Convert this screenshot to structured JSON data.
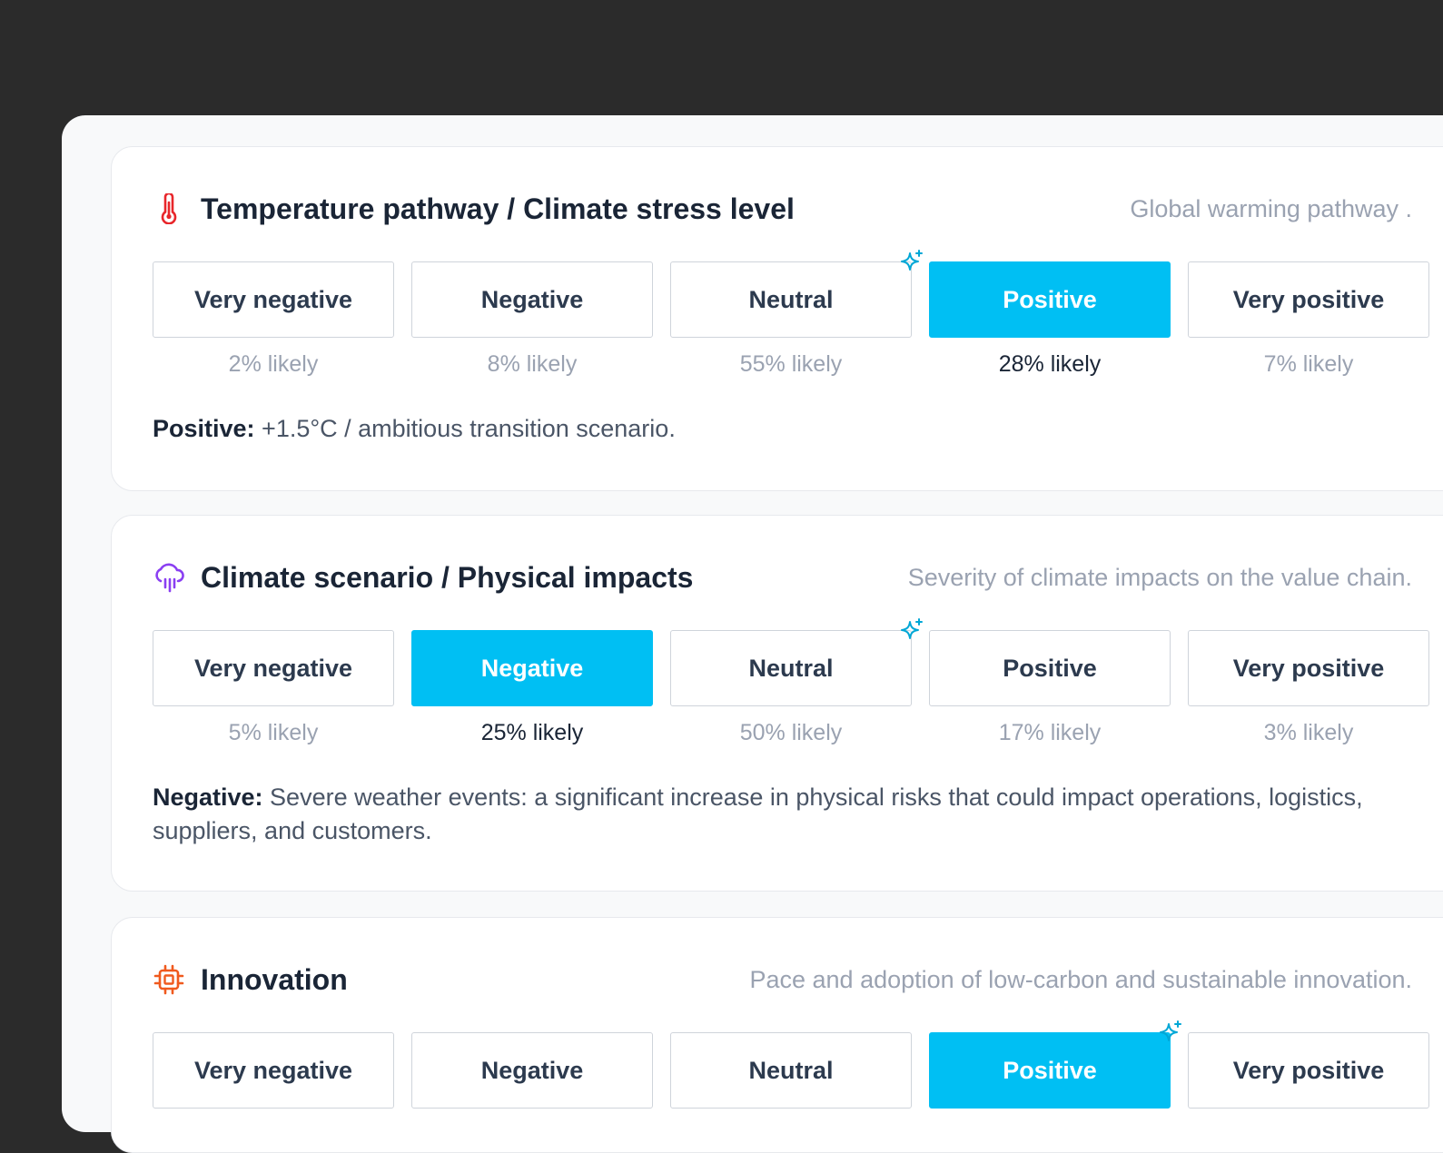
{
  "cards": [
    {
      "icon": "thermometer-icon",
      "icon_color": "#e8262b",
      "title": "Temperature pathway / Climate stress level",
      "description": "Global warming pathway .",
      "options": [
        {
          "label": "Very negative",
          "likely": "2% likely"
        },
        {
          "label": "Negative",
          "likely": "8% likely"
        },
        {
          "label": "Neutral",
          "likely": "55% likely"
        },
        {
          "label": "Positive",
          "likely": "28% likely"
        },
        {
          "label": "Very positive",
          "likely": "7% likely"
        }
      ],
      "selected_index": 3,
      "ai_suggested_index": 2,
      "summary_label": "Positive:",
      "summary_text": " +1.5°C / ambitious transition scenario."
    },
    {
      "icon": "cloud-rain-icon",
      "icon_color": "#8a3ff2",
      "title": "Climate scenario / Physical impacts",
      "description": "Severity of climate impacts on the value chain.",
      "options": [
        {
          "label": "Very negative",
          "likely": "5% likely"
        },
        {
          "label": "Negative",
          "likely": "25% likely"
        },
        {
          "label": "Neutral",
          "likely": "50% likely"
        },
        {
          "label": "Positive",
          "likely": "17% likely"
        },
        {
          "label": "Very positive",
          "likely": "3% likely"
        }
      ],
      "selected_index": 1,
      "ai_suggested_index": 2,
      "summary_label": "Negative:",
      "summary_text": " Severe weather events: a significant increase in physical risks that could impact operations, logistics, suppliers, and customers."
    },
    {
      "icon": "cpu-chip-icon",
      "icon_color": "#f05a1e",
      "title": "Innovation",
      "description": "Pace and adoption of low-carbon and sustainable innovation.",
      "options": [
        {
          "label": "Very negative"
        },
        {
          "label": "Negative"
        },
        {
          "label": "Neutral"
        },
        {
          "label": "Positive"
        },
        {
          "label": "Very positive"
        }
      ],
      "selected_index": 3,
      "ai_suggested_index": 3
    }
  ],
  "colors": {
    "accent": "#00bff3",
    "sparkle": "#00a7d6",
    "title": "#1a2536",
    "muted": "#9aa2b1"
  }
}
